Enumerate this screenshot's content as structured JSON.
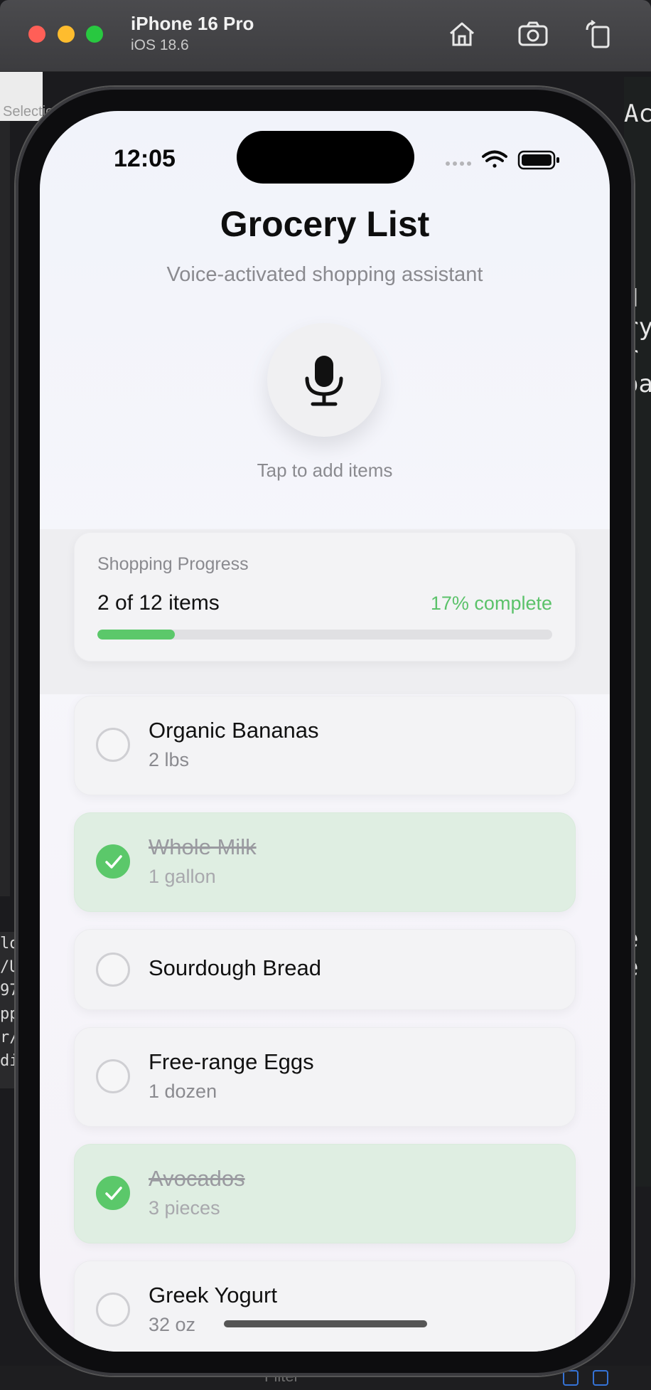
{
  "window": {
    "device_name": "iPhone 16 Pro",
    "os_version": "iOS 18.6",
    "toolbar_icons": [
      "home-icon",
      "screenshot-icon",
      "rotate-icon"
    ]
  },
  "background": {
    "left_label": "Selectio",
    "code_lines": [
      "lo",
      "/U",
      "97",
      "pp",
      "r/",
      "di"
    ],
    "right_lines": [
      "Act",
      "",
      "d",
      "ry",
      "r",
      "oa"
    ],
    "right_lines_lower": [
      "e",
      "e"
    ],
    "filter_placeholder": "Filter"
  },
  "status_bar": {
    "time": "12:05"
  },
  "app": {
    "title": "Grocery List",
    "subtitle": "Voice-activated shopping assistant",
    "mic_label": "Tap to add items"
  },
  "progress": {
    "label": "Shopping Progress",
    "count_text": "2 of 12 items",
    "percent_text": "17% complete",
    "fraction": 0.17
  },
  "items": [
    {
      "name": "Organic Bananas",
      "qty": "2 lbs",
      "checked": false
    },
    {
      "name": "Whole Milk",
      "qty": "1 gallon",
      "checked": true
    },
    {
      "name": "Sourdough Bread",
      "qty": "",
      "checked": false
    },
    {
      "name": "Free-range Eggs",
      "qty": "1 dozen",
      "checked": false
    },
    {
      "name": "Avocados",
      "qty": "3 pieces",
      "checked": true
    },
    {
      "name": "Greek Yogurt",
      "qty": "32 oz",
      "checked": false
    }
  ],
  "colors": {
    "accent_green": "#5bc86a",
    "checked_bg": "#dfeee2"
  }
}
